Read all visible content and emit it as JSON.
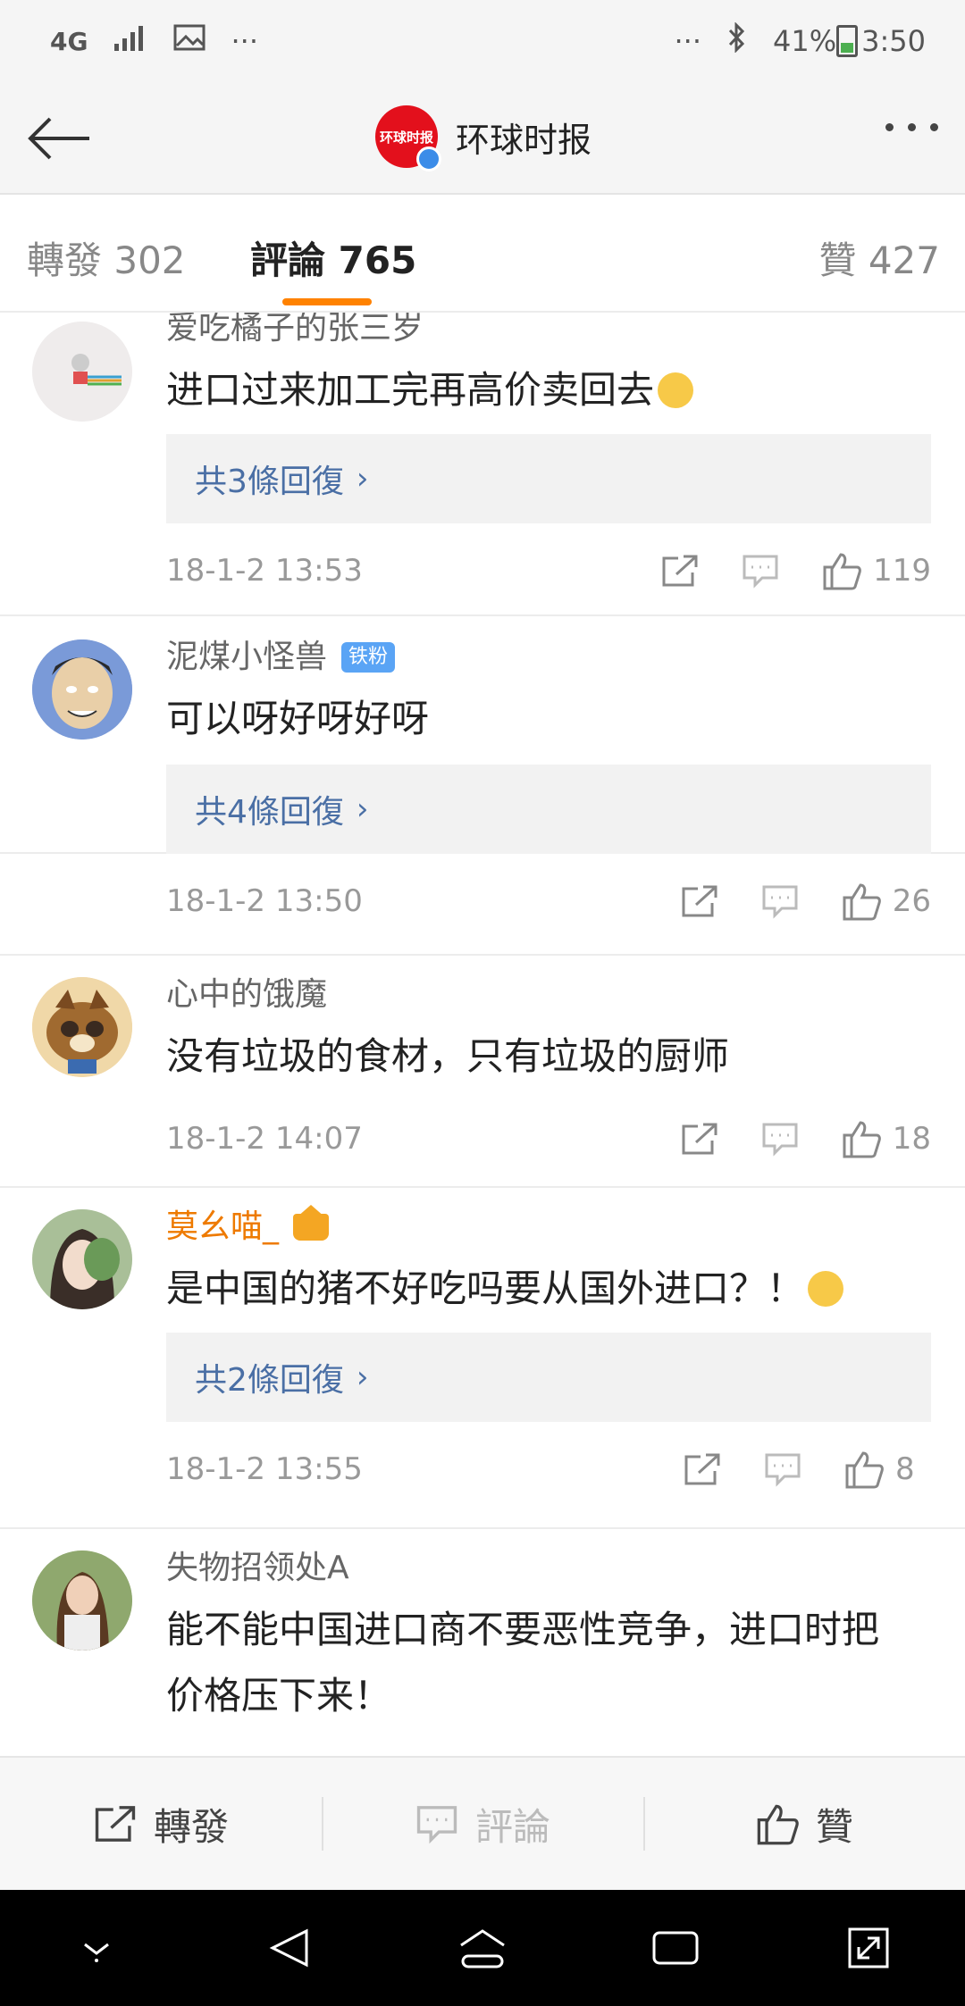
{
  "status_bar": {
    "network": "4G",
    "battery": "41%",
    "time": "3:50",
    "more_left": "···",
    "more_right": "···"
  },
  "nav": {
    "title": "环球时报",
    "logo_text": "环球时报"
  },
  "tabs": [
    {
      "label": "轉發 302"
    },
    {
      "label": "評論 765"
    },
    {
      "label": "贊 427"
    }
  ],
  "comments": [
    {
      "username": "爱吃橘子的张三岁",
      "content": "进口过来加工完再高价卖回去",
      "reply_label": "共3條回復",
      "time": "18-1-2 13:53",
      "likes": "119"
    },
    {
      "username": "泥煤小怪兽",
      "badge": "铁粉",
      "content": "可以呀好呀好呀",
      "reply_label": "共4條回復",
      "time": "18-1-2 13:50",
      "likes": "26"
    },
    {
      "username": "心中的饿魔",
      "content": "没有垃圾的食材，只有垃圾的厨师",
      "time": "18-1-2 14:07",
      "likes": "18"
    },
    {
      "username": "莫幺喵_",
      "content": "是中国的猪不好吃吗要从国外进口？！",
      "reply_label": "共2條回復",
      "time": "18-1-2 13:55",
      "likes": "8"
    },
    {
      "username": "失物招领处A",
      "content_line1": "能不能中国进口商不要恶性竞争，进口时把",
      "content_line2": "价格压下来！"
    }
  ],
  "bottom_bar": {
    "repost": "轉發",
    "comment": "評論",
    "like": "贊"
  },
  "colors": {
    "accent": "#ff8200",
    "link": "#4a6fa5",
    "vip_name": "#ee7a00",
    "badge": "#5aa4f5"
  }
}
